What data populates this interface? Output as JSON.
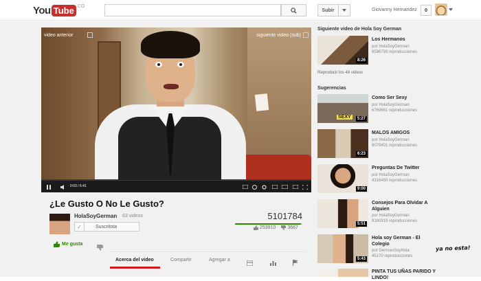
{
  "header": {
    "logo_you": "You",
    "logo_tube": "Tube",
    "logo_region": "CO",
    "search_placeholder": "",
    "upload_label": "Subir",
    "user_name": "Giovanny Hernandez",
    "notification_count": "0"
  },
  "player": {
    "prev_label": "video anterior",
    "next_label": "siguiente video (sub)",
    "time": "0:03 / 6:41"
  },
  "video": {
    "title": "¿Le Gusto O No Le Gusto?",
    "channel": "HolaSoyGerman",
    "channel_video_count": "63 videos",
    "subscribe_label": "Suscritota",
    "views": "5101784",
    "views_fill_fraction": 0.98,
    "likes": "253910",
    "dislikes": "3667",
    "like_label": "Me gusta"
  },
  "tabs": [
    {
      "label": "Acerca del video"
    },
    {
      "label": "Compartir"
    },
    {
      "label": "Agregar a"
    }
  ],
  "sidebar": {
    "next_heading": "Siguiente video de Hola Soy German",
    "next_video": {
      "title": "Los Hermanos",
      "by": "por HolaSoyGerman",
      "views": "6596793 reproducciones",
      "duration": "8:26"
    },
    "playlist_link": "Reproducir los 48 videos",
    "suggestions_heading": "Sugerencias",
    "suggestions": [
      {
        "title": "Como Ser Sexy",
        "by": "por HolaSoyGerman",
        "views": "6769661 reproducciones",
        "duration": "5:27",
        "thumb_text": "SEXY"
      },
      {
        "title": "MALOS AMIGOS",
        "by": "por HolaSoyGerman",
        "views": "6079401 reproducciones",
        "duration": "6:23",
        "thumb_text": ""
      },
      {
        "title": "Preguntas De Twitter",
        "by": "por HolaSoyGerman",
        "views": "4316450 reproducciones",
        "duration": "9:00",
        "thumb_text": ""
      },
      {
        "title": "Consejos Para Olvidar A Alguien",
        "by": "por HolaSoyGerman",
        "views": "9180919 reproducciones",
        "duration": "5:51",
        "thumb_text": ""
      },
      {
        "title": "Hola soy German - El Colegio",
        "by": "por GermanSoyHola",
        "views": "45170 reproducciones",
        "duration": "5:43",
        "thumb_text": ""
      },
      {
        "title": "PINTA TUS UÑAS PARIDO Y LINDO!",
        "by": "",
        "views": "",
        "duration": "",
        "thumb_text": ""
      }
    ]
  },
  "annotation": "ya no esta!",
  "colors": {
    "accent_red": "#cc181e",
    "like_green": "#2b8a00",
    "logo_red": "#c4302b"
  }
}
